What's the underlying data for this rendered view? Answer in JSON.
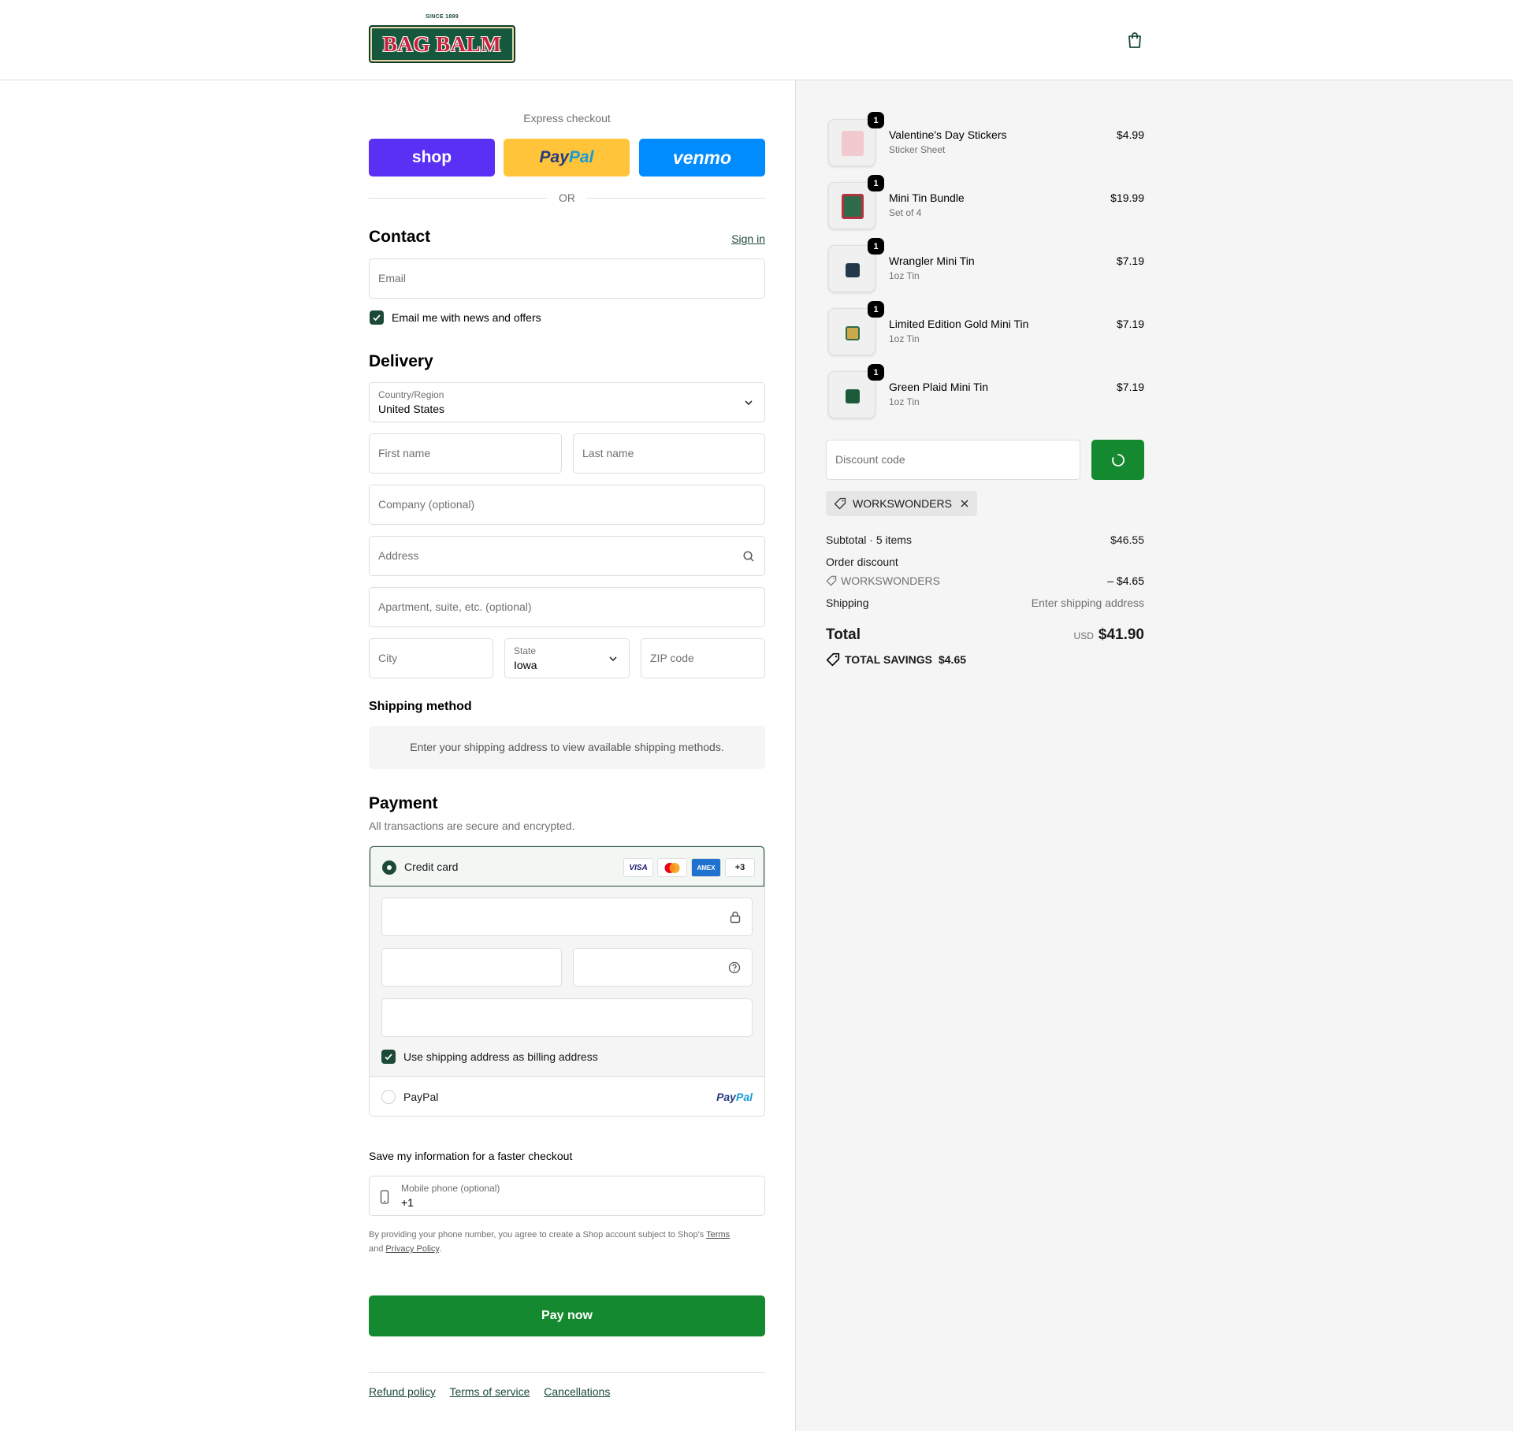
{
  "header": {
    "logo_since": "SINCE 1899",
    "logo_text": "BAG BALM",
    "cart_icon": "shopping-bag-icon"
  },
  "express": {
    "label": "Express checkout",
    "shop_label": "shop",
    "paypal_label_1": "Pay",
    "paypal_label_2": "Pal",
    "venmo_label": "venmo",
    "or": "OR"
  },
  "contact": {
    "title": "Contact",
    "sign_in": "Sign in",
    "email_placeholder": "Email",
    "newsletter_label": "Email me with news and offers",
    "newsletter_checked": true
  },
  "delivery": {
    "title": "Delivery",
    "country_label": "Country/Region",
    "country_value": "United States",
    "first_name_placeholder": "First name",
    "last_name_placeholder": "Last name",
    "company_placeholder": "Company (optional)",
    "address_placeholder": "Address",
    "apartment_placeholder": "Apartment, suite, etc. (optional)",
    "city_placeholder": "City",
    "state_label": "State",
    "state_value": "Iowa",
    "zip_placeholder": "ZIP code"
  },
  "shipping_method": {
    "title": "Shipping method",
    "message": "Enter your shipping address to view available shipping methods."
  },
  "payment": {
    "title": "Payment",
    "subtitle": "All transactions are secure and encrypted.",
    "credit_card_label": "Credit card",
    "card_logos": [
      "VISA",
      "",
      "AMEX",
      "+3"
    ],
    "billing_label": "Use shipping address as billing address",
    "billing_checked": true,
    "paypal_label": "PayPal",
    "paypal_logo_1": "Pay",
    "paypal_logo_2": "Pal"
  },
  "save_info": {
    "title": "Save my information for a faster checkout",
    "phone_label": "Mobile phone (optional)",
    "phone_value": "+1",
    "legal_1": "By providing your phone number, you agree to create a Shop account subject to Shop's ",
    "legal_terms": "Terms",
    "legal_2": "and ",
    "legal_privacy": "Privacy Policy",
    "legal_3": "."
  },
  "pay_now": "Pay now",
  "footer": {
    "links": [
      "Refund policy",
      "Terms of service",
      "Cancellations"
    ]
  },
  "summary": {
    "items": [
      {
        "name": "Valentine's Day Stickers",
        "variant": "Sticker Sheet",
        "price": "$4.99",
        "qty": "1",
        "color": "#f2c9cf"
      },
      {
        "name": "Mini Tin Bundle",
        "variant": "Set of 4",
        "price": "$19.99",
        "qty": "1",
        "color": "#2f6b4a"
      },
      {
        "name": "Wrangler Mini Tin",
        "variant": "1oz Tin",
        "price": "$7.19",
        "qty": "1",
        "color": "#23384a"
      },
      {
        "name": "Limited Edition Gold Mini Tin",
        "variant": "1oz Tin",
        "price": "$7.19",
        "qty": "1",
        "color": "#c9a94a"
      },
      {
        "name": "Green Plaid Mini Tin",
        "variant": "1oz Tin",
        "price": "$7.19",
        "qty": "1",
        "color": "#1d5a3a"
      }
    ],
    "discount_placeholder": "Discount code",
    "applied_code": "WORKSWONDERS",
    "subtotal_label": "Subtotal · 5 items",
    "subtotal_value": "$46.55",
    "order_discount_label": "Order discount",
    "discount_code_line": "WORKSWONDERS",
    "discount_value": "– $4.65",
    "shipping_label": "Shipping",
    "shipping_value": "Enter shipping address",
    "total_label": "Total",
    "total_currency": "USD",
    "total_value": "$41.90",
    "savings_label": "TOTAL SAVINGS",
    "savings_value": "$4.65"
  },
  "colors": {
    "brand_green": "#1c4a36",
    "pay_button": "#15892f",
    "shop_purple": "#5a31f4",
    "paypal_yellow": "#ffc439",
    "venmo_blue": "#008cff"
  }
}
